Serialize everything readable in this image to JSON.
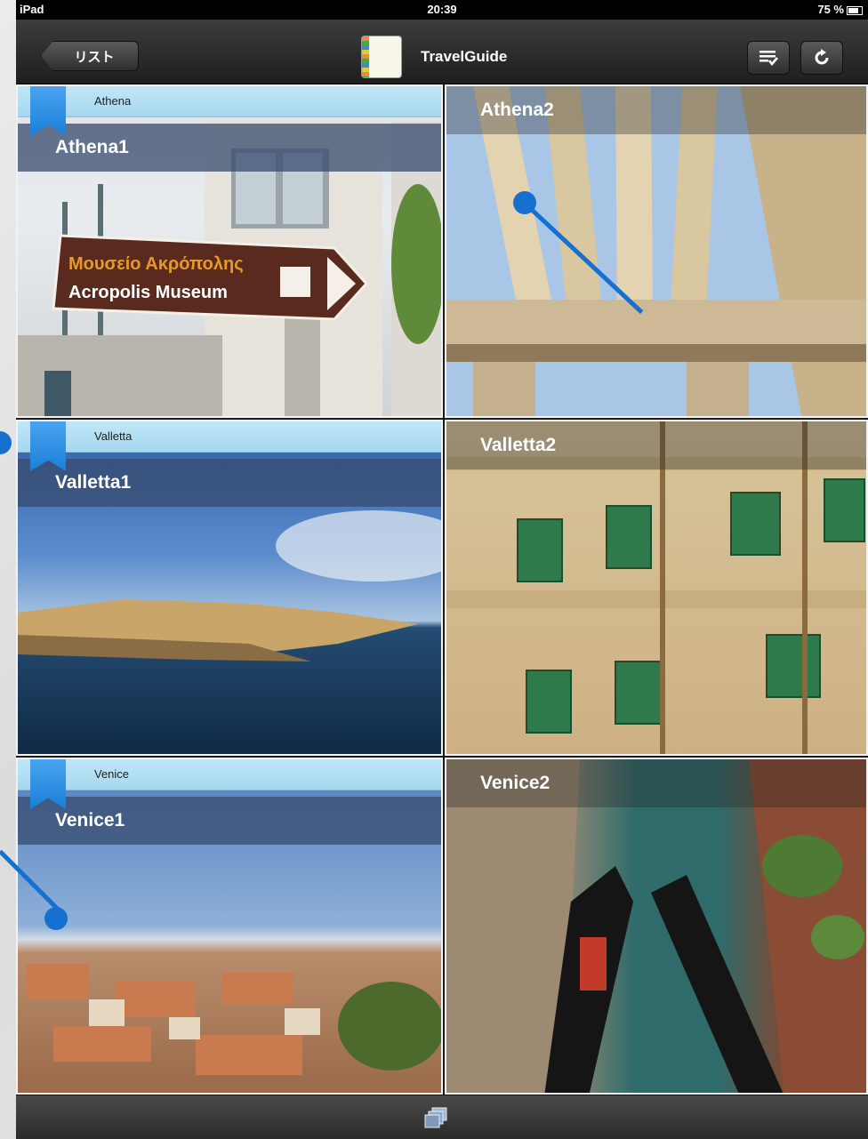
{
  "status_bar": {
    "device": "iPad",
    "time": "20:39",
    "battery": "75 %"
  },
  "nav": {
    "back_label": "リスト",
    "title": "TravelGuide",
    "list_icon": "list-check-icon",
    "refresh_icon": "refresh-icon"
  },
  "grid": {
    "rows": [
      {
        "section": "Athena",
        "left": {
          "label": "Athena1"
        },
        "right": {
          "label": "Athena2"
        }
      },
      {
        "section": "Valletta",
        "left": {
          "label": "Valletta1"
        },
        "right": {
          "label": "Valletta2"
        }
      },
      {
        "section": "Venice",
        "left": {
          "label": "Venice1"
        },
        "right": {
          "label": "Venice2"
        }
      }
    ]
  },
  "sign": {
    "line1": "Μουσείο Ακρόπολης",
    "line2": "Acropolis Museum"
  },
  "toolbar": {
    "icon": "stacked-pages-icon"
  },
  "colors": {
    "accent": "#1670d0",
    "header": "#bfe6f8"
  }
}
